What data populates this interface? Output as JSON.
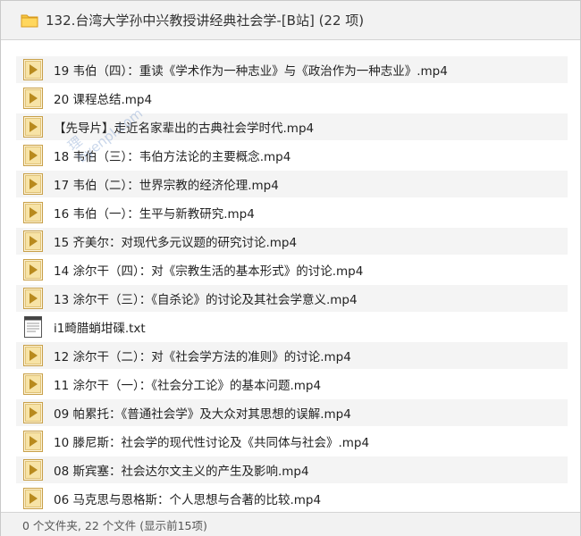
{
  "header": {
    "title": "132.台湾大学孙中兴教授讲经典社会学-[B站] (22 项)",
    "icon": "folder-icon"
  },
  "files": [
    {
      "name": "19 韦伯（四）：重读《学术作为一种志业》与《政治作为一种志业》.mp4",
      "type": "video"
    },
    {
      "name": "20 课程总结.mp4",
      "type": "video"
    },
    {
      "name": "【先导片】走近名家辈出的古典社会学时代.mp4",
      "type": "video"
    },
    {
      "name": "18 韦伯（三）：韦伯方法论的主要概念.mp4",
      "type": "video"
    },
    {
      "name": "17 韦伯（二）：世界宗教的经济伦理.mp4",
      "type": "video"
    },
    {
      "name": "16 韦伯（一）：生平与新教研究.mp4",
      "type": "video"
    },
    {
      "name": "15 齐美尔：对现代多元议题的研究讨论.mp4",
      "type": "video"
    },
    {
      "name": "14 涂尔干（四）：对《宗教生活的基本形式》的讨论.mp4",
      "type": "video"
    },
    {
      "name": "13 涂尔干（三）：《自杀论》的讨论及其社会学意义.mp4",
      "type": "video"
    },
    {
      "name": "i1畸腊蛸坩磲.txt",
      "type": "text"
    },
    {
      "name": "12 涂尔干（二）：对《社会学方法的准则》的讨论.mp4",
      "type": "video"
    },
    {
      "name": "11 涂尔干（一）：《社会分工论》的基本问题.mp4",
      "type": "video"
    },
    {
      "name": "09 帕累托：《普通社会学》及大众对其思想的误解.mp4",
      "type": "video"
    },
    {
      "name": "10 滕尼斯：社会学的现代性讨论及《共同体与社会》.mp4",
      "type": "video"
    },
    {
      "name": "08 斯宾塞：社会达尔文主义的产生及影响.mp4",
      "type": "video"
    },
    {
      "name": "06 马克思与恩格斯：个人思想与合著的比较.mp4",
      "type": "video"
    }
  ],
  "watermark": {
    "line1": "理",
    "line2": "byenpl.com"
  },
  "status": {
    "text": "0 个文件夹, 22 个文件 (显示前15项)"
  },
  "colors": {
    "accent": "#e0a02a",
    "video_icon": "#c8a04a",
    "stripe": "#f4f4f4"
  }
}
